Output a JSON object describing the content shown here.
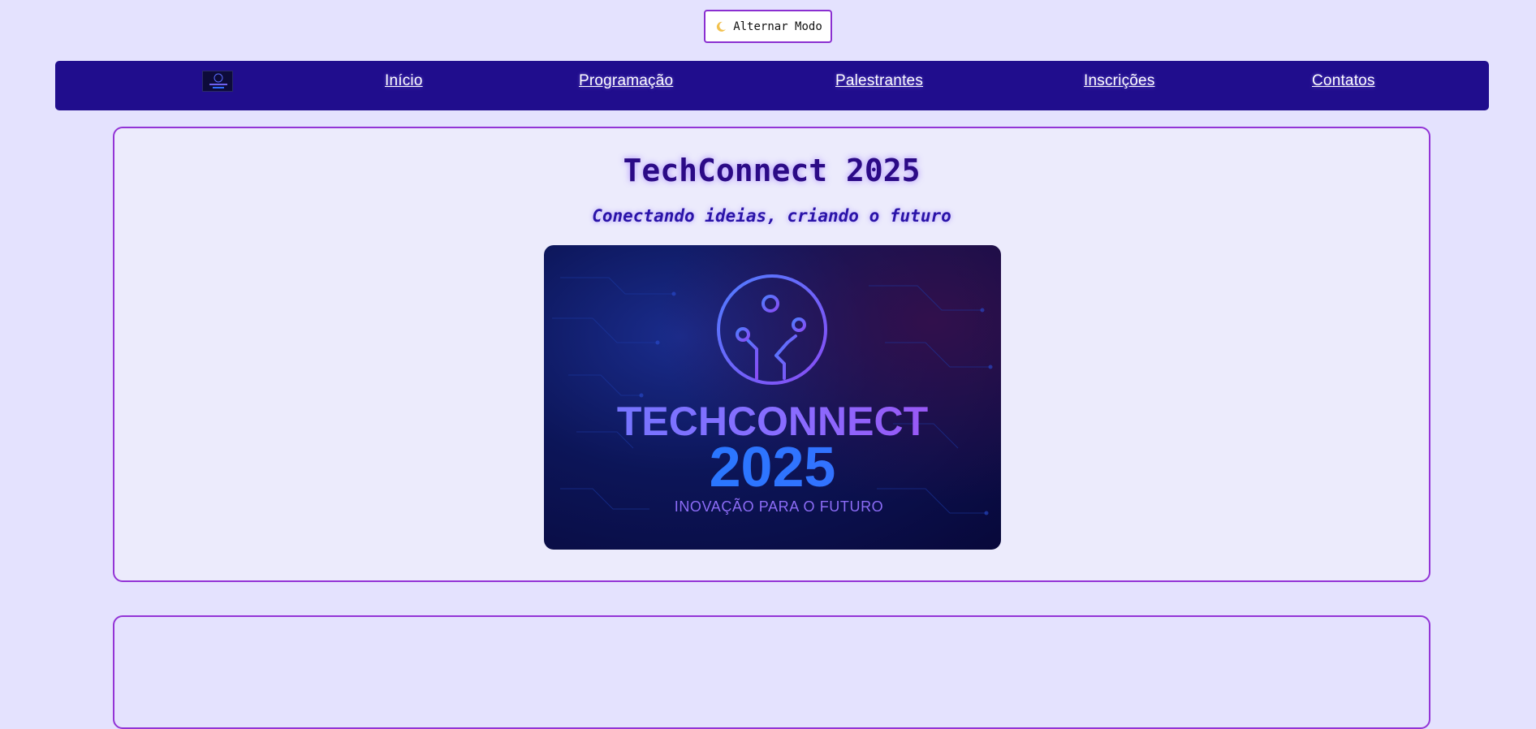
{
  "theme_toggle": {
    "icon": "moon-icon",
    "label": "Alternar Modo"
  },
  "nav": {
    "logo_icon": "techconnect-logo-icon",
    "links": [
      {
        "label": "Início"
      },
      {
        "label": "Programação"
      },
      {
        "label": "Palestrantes"
      },
      {
        "label": "Inscrições"
      },
      {
        "label": "Contatos"
      }
    ]
  },
  "hero": {
    "title": "TechConnect 2025",
    "subtitle": "Conectando ideias, criando o futuro",
    "banner": {
      "icon": "circuit-logo-icon",
      "title": "TECHCONNECT",
      "year": "2025",
      "tagline": "INOVAÇÃO PARA O FUTURO"
    }
  },
  "colors": {
    "page_background": "#e4e2fe",
    "nav_background": "#200d8d",
    "card_border": "#9334d6",
    "card_background": "#ecebfc",
    "title_color": "#2b0a86"
  }
}
